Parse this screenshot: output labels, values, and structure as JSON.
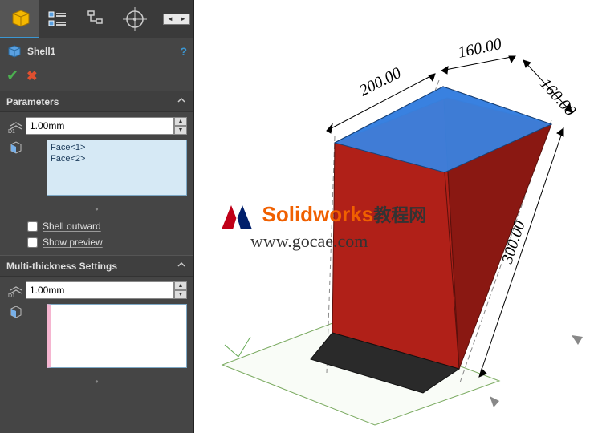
{
  "feature": {
    "name": "Shell1"
  },
  "sections": {
    "parameters": {
      "title": "Parameters",
      "thickness_value": "1.00mm",
      "faces": [
        "Face<1>",
        "Face<2>"
      ],
      "shell_outward_label": "Shell outward",
      "show_preview_label": "Show preview",
      "shell_outward_checked": false,
      "show_preview_checked": false
    },
    "multi": {
      "title": "Multi-thickness Settings",
      "thickness_value": "1.00mm"
    }
  },
  "dimensions": {
    "d1": "160.00",
    "d2": "160.00",
    "d3": "200.00",
    "d4": "300.00"
  },
  "watermark": {
    "brand": "Solidworks",
    "brand_cn": "教程网",
    "url": "www.gocae.com"
  },
  "icons": {
    "cube": "cube",
    "list": "list",
    "tree": "tree",
    "target": "target"
  }
}
